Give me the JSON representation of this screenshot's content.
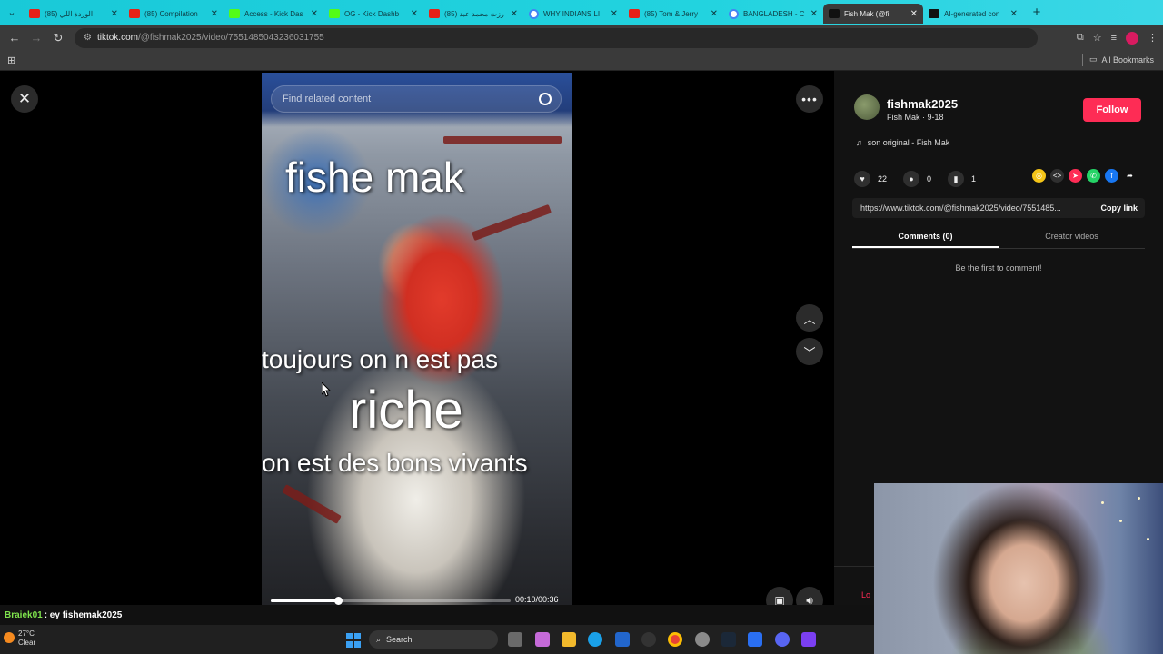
{
  "browser": {
    "tabs": [
      {
        "title": "الوردة اللي (85)",
        "favicon": "youtube-icon",
        "color": "#e62117",
        "active": false
      },
      {
        "title": "(85) Compilation",
        "favicon": "youtube-icon",
        "color": "#e62117",
        "active": false
      },
      {
        "title": "Access - Kick Das",
        "favicon": "kick-icon",
        "color": "#53fc18",
        "active": false
      },
      {
        "title": "OG - Kick Dashb",
        "favicon": "kick-icon",
        "color": "#53fc18",
        "active": false
      },
      {
        "title": "(85) رزت محمد عبد",
        "favicon": "youtube-icon",
        "color": "#e62117",
        "active": false
      },
      {
        "title": "WHY INDIANS LI",
        "favicon": "google-icon",
        "color": "#4285f4",
        "active": false
      },
      {
        "title": "(85) Tom & Jerry",
        "favicon": "youtube-icon",
        "color": "#e62117",
        "active": false
      },
      {
        "title": "BANGLADESH - C",
        "favicon": "google-icon",
        "color": "#4285f4",
        "active": false
      },
      {
        "title": "Fish Mak (@fi",
        "favicon": "tiktok-icon",
        "color": "#111111",
        "active": true
      },
      {
        "title": "AI-generated con",
        "favicon": "tiktok-icon",
        "color": "#111111",
        "active": false
      }
    ],
    "url_host": "tiktok.com",
    "url_path": "/@fishmak2025/video/7551485043236031755",
    "all_bookmarks": "All Bookmarks"
  },
  "video": {
    "search_placeholder": "Find related content",
    "overlay": {
      "line1": "fishe mak",
      "line2": "toujours  on n est pas",
      "line3": "riche",
      "line4": "on est des bons vivants"
    },
    "time": "00:10/00:36",
    "progress_fraction": 0.28
  },
  "panel": {
    "username": "fishmak2025",
    "subtitle": "Fish Mak · 9-18",
    "follow": "Follow",
    "music": "son original - Fish Mak",
    "likes": "22",
    "comments": "0",
    "saves": "1",
    "link": "https://www.tiktok.com/@fishmak2025/video/7551485...",
    "copy_link": "Copy link",
    "tab_comments": "Comments (0)",
    "tab_creator": "Creator videos",
    "empty": "Be the first to comment!",
    "login_fragment": "Lo"
  },
  "chat": {
    "user": "Braiek01",
    "message": ": ey fishemak2025"
  },
  "taskbar": {
    "temp": "27°C",
    "weather": "Clear",
    "search": "Search"
  },
  "colors": {
    "accent": "#fe2c55",
    "tabstrip": "#22d3df"
  }
}
